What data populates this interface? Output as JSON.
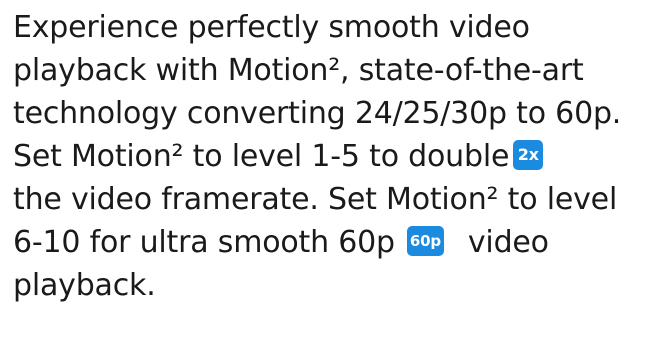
{
  "paragraph": {
    "line1": "Experience perfectly smooth video",
    "line2": "playback with Motion², state-of-the-art",
    "line3": "technology converting 24/25/30p to 60p.",
    "line4": "Set Motion² to level 1-5 to double",
    "line5": "the video framerate. Set Motion² to level",
    "line6_before": "6-10 for ultra smooth 60p",
    "line6_after": "video",
    "line7": "playback."
  },
  "badges": {
    "double": {
      "label": "2x",
      "color": "#1b8be0"
    },
    "smooth60p": {
      "label": "60p",
      "color": "#1b8be0"
    }
  }
}
